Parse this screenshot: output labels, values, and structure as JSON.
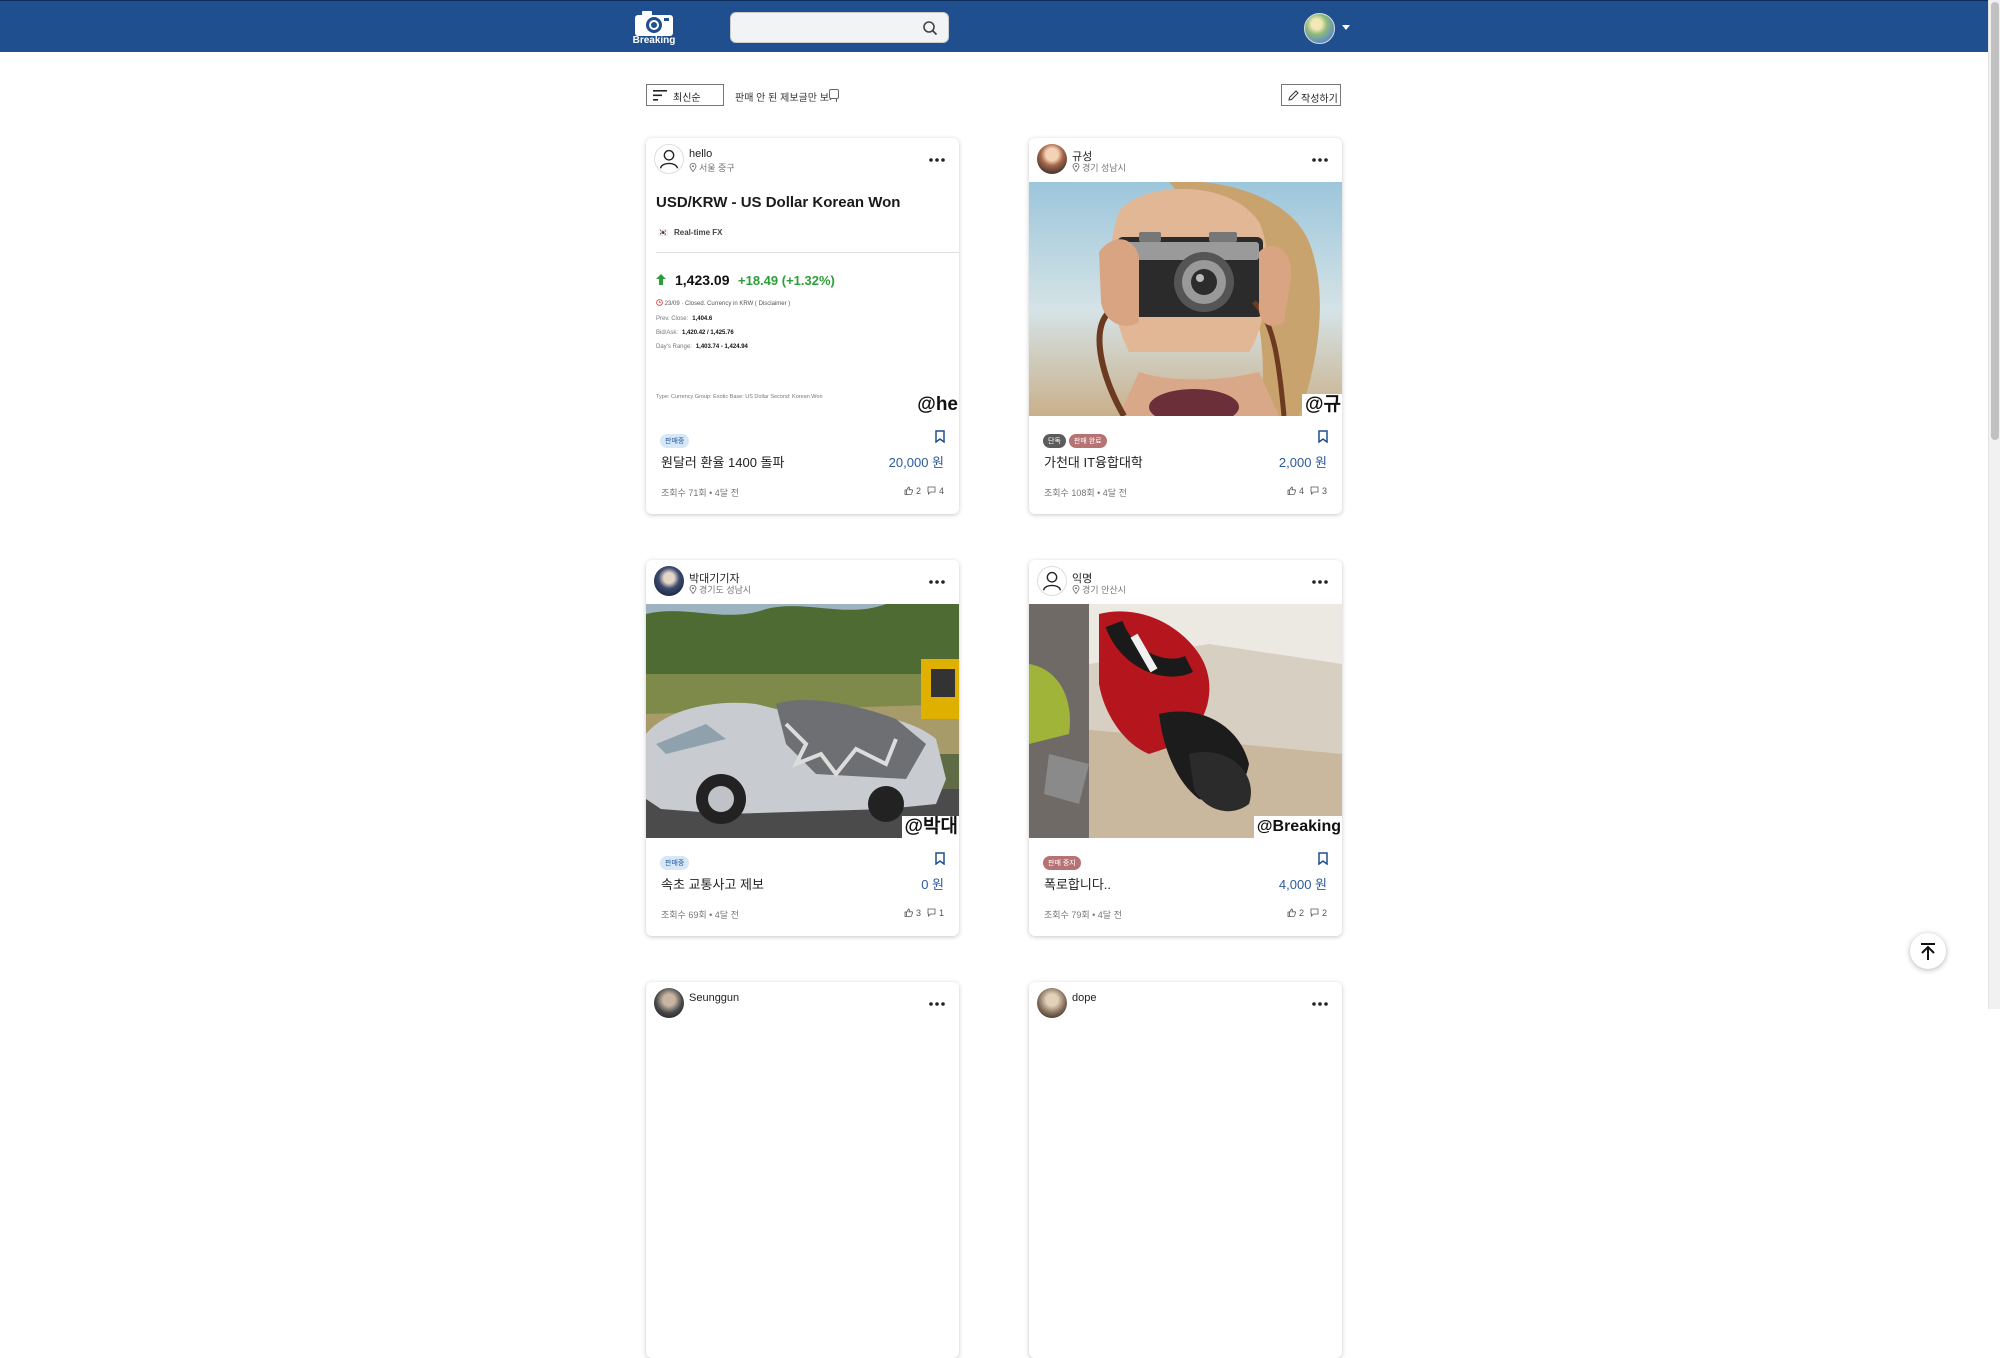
{
  "header": {
    "logo_text": "Breaking",
    "search_placeholder": "",
    "accent": "#1f4f8f"
  },
  "toolbar": {
    "sort_label": "최신순",
    "unsold_label": "판매 안 된 제보글만 보기",
    "write_label": "작성하기"
  },
  "cards": [
    {
      "author": "hello",
      "location": "서울 중구",
      "watermark": "@he",
      "badges": [
        {
          "label": "판매중",
          "type": "selling"
        }
      ],
      "title": "원달러 환율 1400 돌파",
      "price": "20,000 원",
      "meta": "조회수 71회 • 4달 전",
      "likes": "2",
      "comments": "4",
      "fx": {
        "title": "USD/KRW - US Dollar Korean Won",
        "flag": "🇰🇷",
        "subtitle": "Real-time FX",
        "rate": "1,423.09",
        "change": "+18.49  (+1.32%)",
        "closed": "23/09 · Closed.  Currency in KRW  ( Disclaimer )",
        "prev_close_label": "Prev. Close:",
        "prev_close": "1,404.6",
        "bid_ask_label": "Bid/Ask:",
        "bid_ask": "1,420.42 / 1,425.76",
        "range_label": "Day's Range:",
        "range": "1,403.74 - 1,424.94",
        "type_line": "Type: Currency   Group: Exotic   Base: US Dollar   Second: Korean Won"
      }
    },
    {
      "author": "규성",
      "location": "경기 성남시",
      "watermark": "@규",
      "badges": [
        {
          "label": "단독",
          "type": "exclusive"
        },
        {
          "label": "판매 완료",
          "type": "sold"
        }
      ],
      "title": "가천대 IT융합대학",
      "price": "2,000 원",
      "meta": "조회수 108회 • 4달 전",
      "likes": "4",
      "comments": "3"
    },
    {
      "author": "박대기기자",
      "location": "경기도 성남시",
      "watermark": "@박대",
      "badges": [
        {
          "label": "판매중",
          "type": "selling"
        }
      ],
      "title": "속초 교통사고 제보",
      "price": "0 원",
      "meta": "조회수 69회 • 4달 전",
      "likes": "3",
      "comments": "1"
    },
    {
      "author": "익명",
      "location": "경기 안산시",
      "watermark": "@Breaking",
      "badges": [
        {
          "label": "판매 중지",
          "type": "stopped"
        }
      ],
      "title": "폭로합니다..",
      "price": "4,000 원",
      "meta": "조회수 79회 • 4달 전",
      "likes": "2",
      "comments": "2"
    },
    {
      "author": "Seunggun"
    },
    {
      "author": "dope"
    }
  ]
}
